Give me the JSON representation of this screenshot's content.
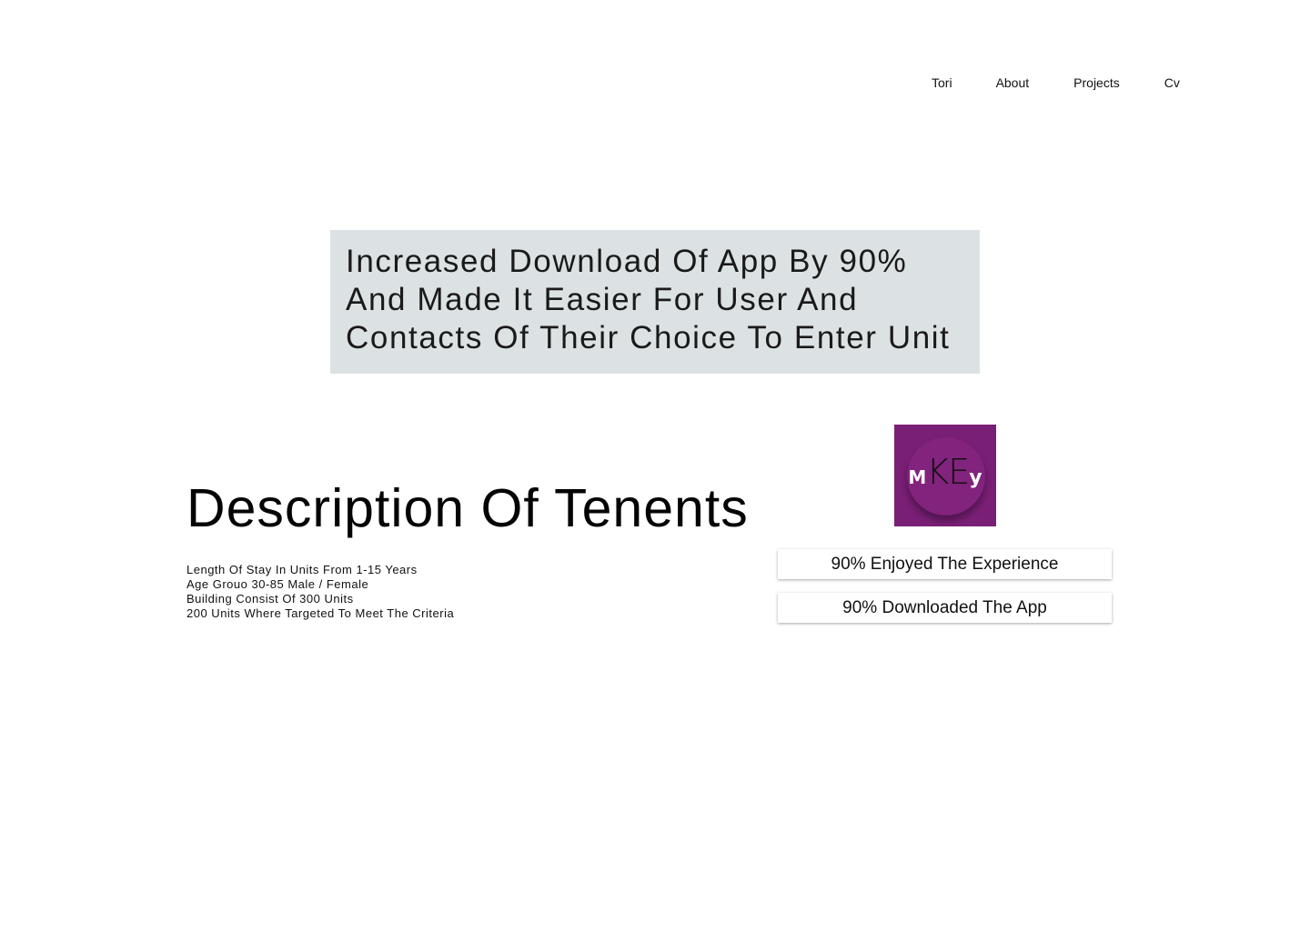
{
  "nav": {
    "items": [
      {
        "label": "Tori"
      },
      {
        "label": "About"
      },
      {
        "label": "Projects"
      },
      {
        "label": "Cv"
      }
    ]
  },
  "banner": {
    "text": "Increased Download Of App By 90%\nAnd Made It Easier For User And\nContacts Of Their Choice To Enter Unit"
  },
  "description": {
    "title": "Description Of Tenents",
    "items": [
      "Length Of Stay In Units From 1-15 Years",
      "Age Grouo 30-85 Male / Female",
      "Building Consist Of 300 Units",
      "200 Units Where Targeted To Meet The Criteria"
    ]
  },
  "logo": {
    "part_m": "M",
    "part_ke": "KE",
    "part_y": "y",
    "colors": {
      "background": "#7a1f76",
      "letters_light": "#ffffff",
      "letters_dark": "#111111"
    }
  },
  "stats": [
    {
      "label": "90% Enjoyed The Experience"
    },
    {
      "label": "90% Downloaded The App"
    }
  ],
  "colors": {
    "banner_background": "#dce2e3",
    "page_background": "#ffffff",
    "text": "#111111"
  }
}
